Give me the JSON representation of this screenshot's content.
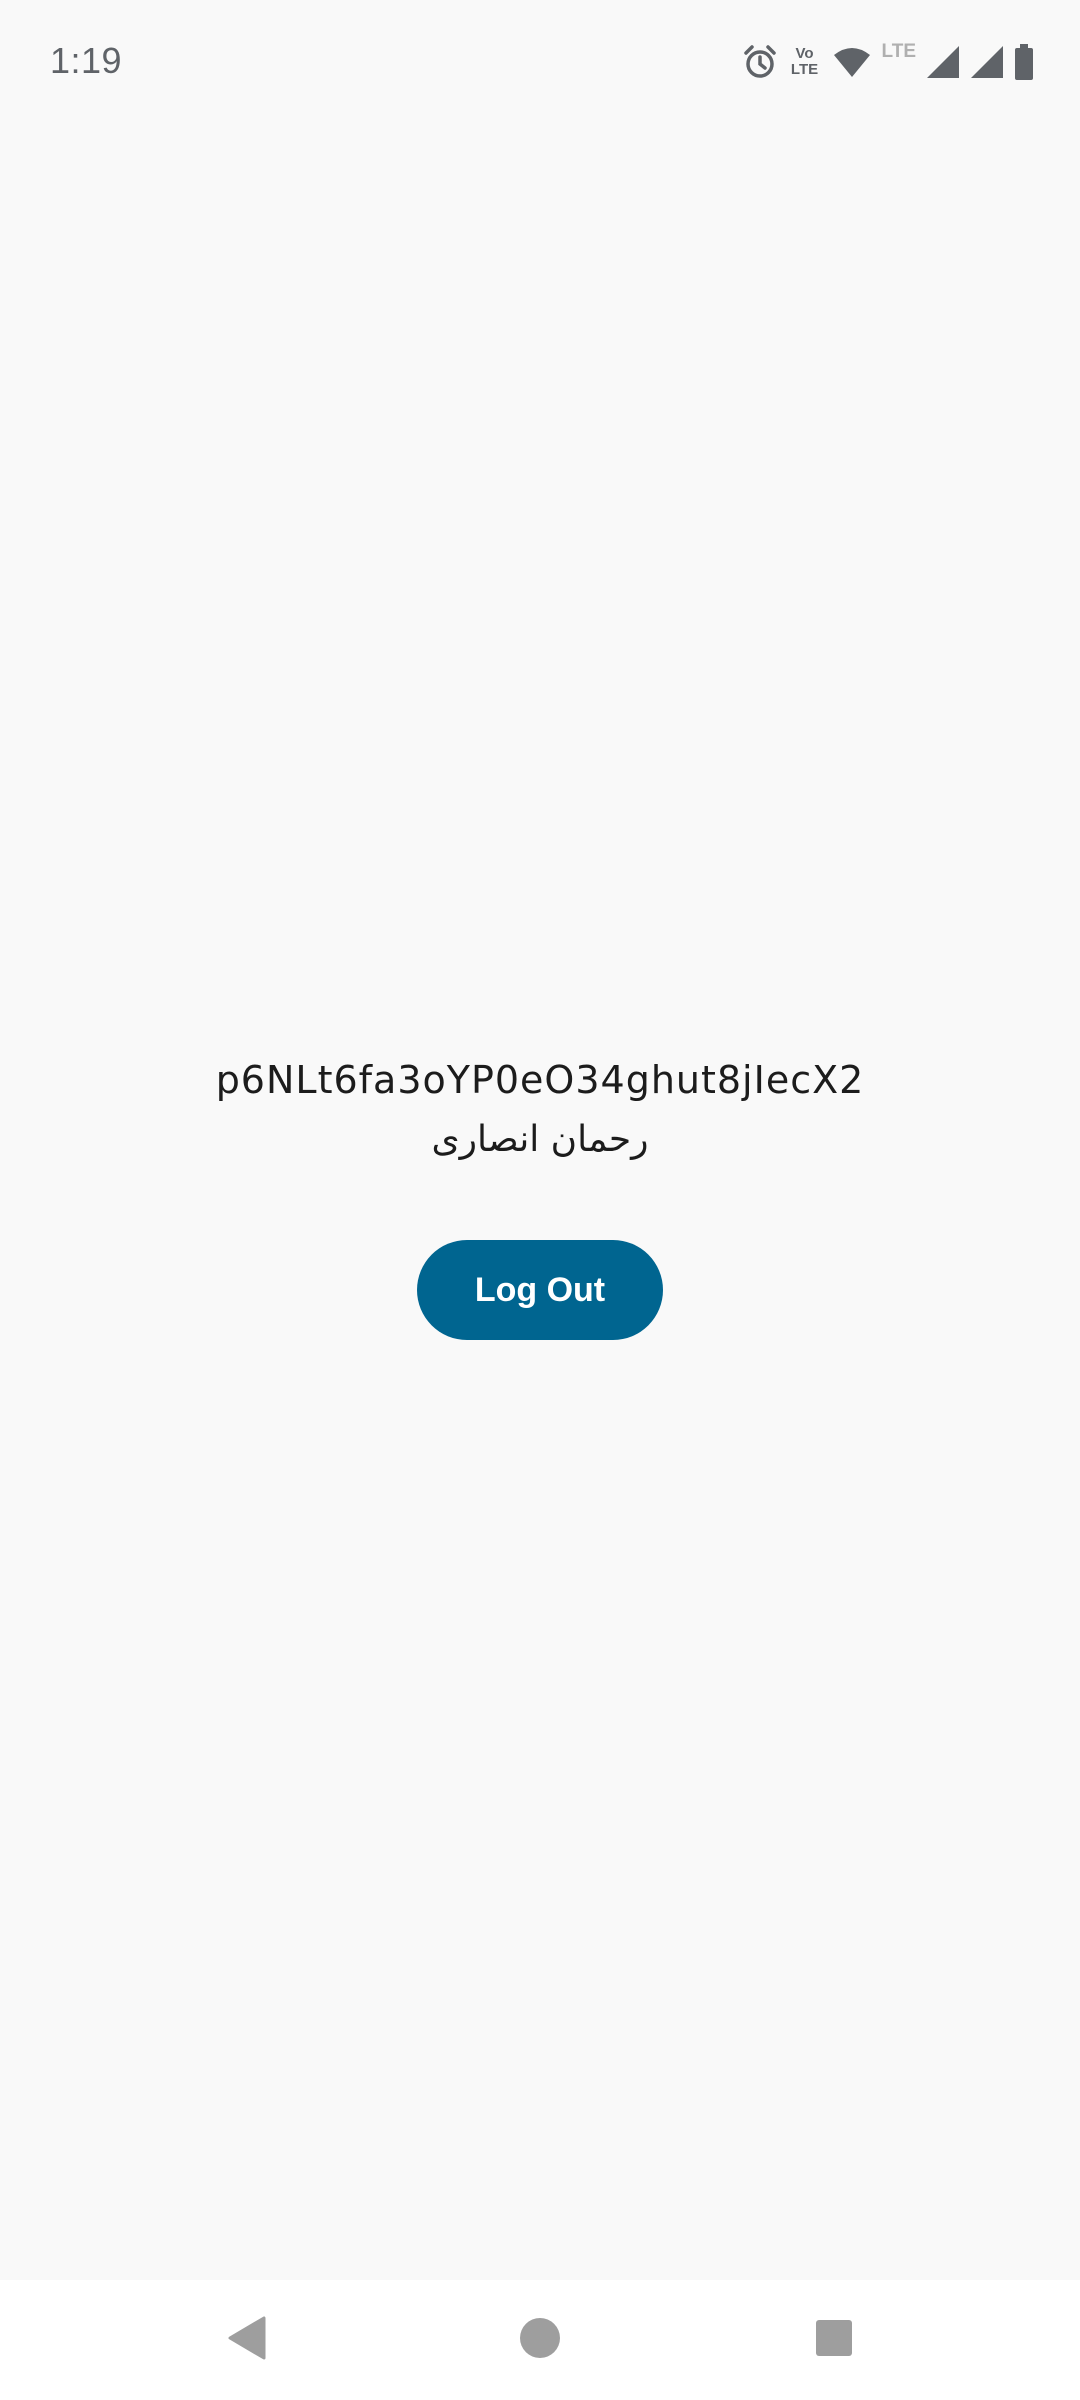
{
  "status_bar": {
    "time": "1:19",
    "volte_line1": "Vo",
    "volte_line2": "LTE",
    "lte_label": "LTE",
    "icons": [
      "alarm-icon",
      "volte-icon",
      "wifi-icon",
      "lte-icon",
      "signal-icon",
      "signal-icon",
      "battery-icon"
    ],
    "icon_color": "#5f6368"
  },
  "profile": {
    "user_id": "p6NLt6fa3oYP0eO34ghut8jIecX2",
    "display_name": "رحمان انصاری"
  },
  "actions": {
    "logout_label": "Log Out",
    "logout_color": "#006590"
  },
  "nav_bar": {
    "icons": [
      "back-icon",
      "home-icon",
      "recents-icon"
    ],
    "icon_color": "#9e9e9e"
  }
}
